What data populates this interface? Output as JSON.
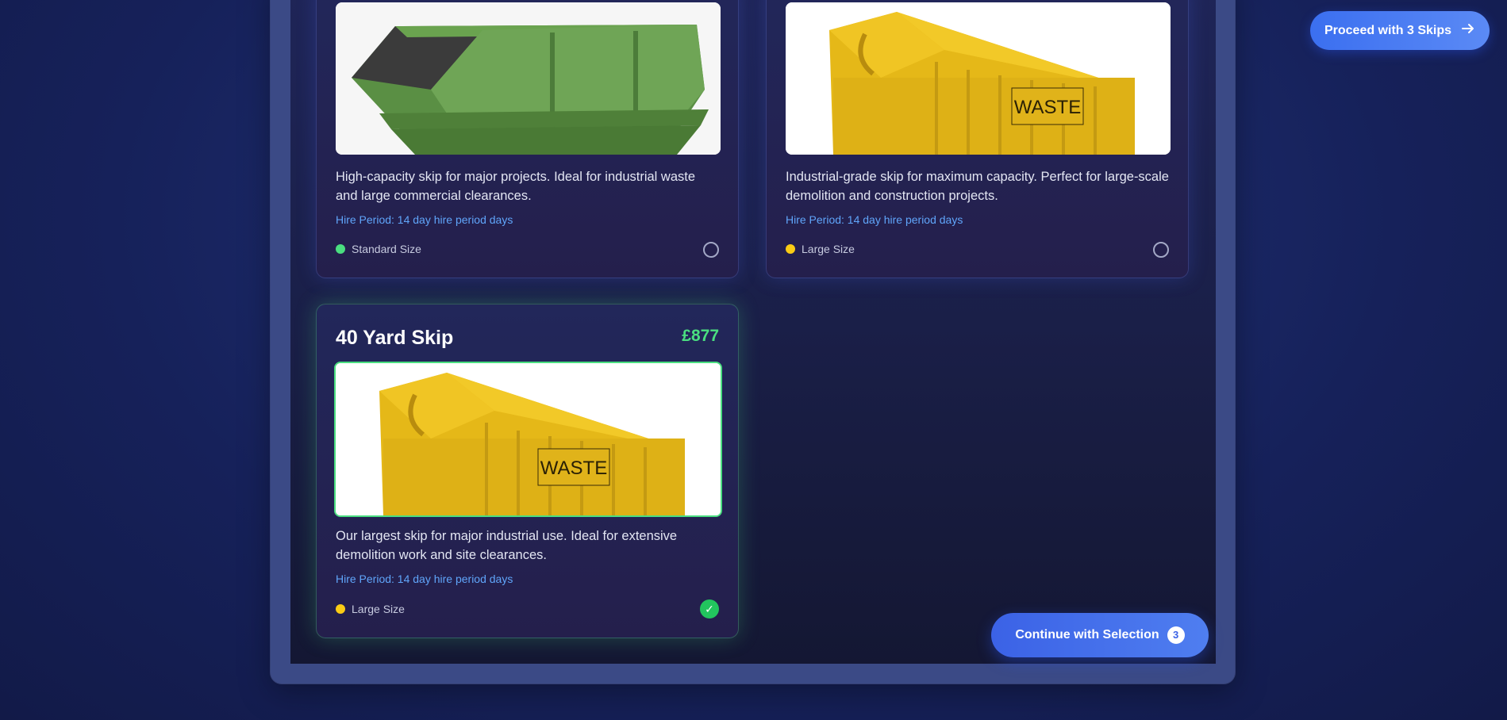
{
  "header": {
    "proceed_label": "Proceed with 3 Skips",
    "proceed_icon": "arrow-right-icon"
  },
  "cards": [
    {
      "title": "",
      "price": "",
      "description": "High-capacity skip for major projects. Ideal for industrial waste and large commercial clearances.",
      "hire_period": "Hire Period: 14 day hire period days",
      "size_label": "Standard Size",
      "size_color": "#4ade80",
      "image": "green-skip",
      "selected": false
    },
    {
      "title": "",
      "price": "",
      "description": "Industrial-grade skip for maximum capacity. Perfect for large-scale demolition and construction projects.",
      "hire_period": "Hire Period: 14 day hire period days",
      "size_label": "Large Size",
      "size_color": "#facc15",
      "image": "yellow-roro-skip",
      "image_text": "WASTE",
      "selected": false
    },
    {
      "title": "40 Yard Skip",
      "price": "£877",
      "description": "Our largest skip for major industrial use. Ideal for extensive demolition work and site clearances.",
      "hire_period": "Hire Period: 14 day hire period days",
      "size_label": "Large Size",
      "size_color": "#facc15",
      "image": "yellow-roro-skip",
      "image_text": "WASTE",
      "selected": true
    }
  ],
  "footer": {
    "continue_label": "Continue with Selection",
    "selection_count": "3"
  },
  "colors": {
    "accent_blue": "#3b6ff0",
    "selected_green": "#4ade80",
    "hire_blue": "#60a5fa"
  }
}
